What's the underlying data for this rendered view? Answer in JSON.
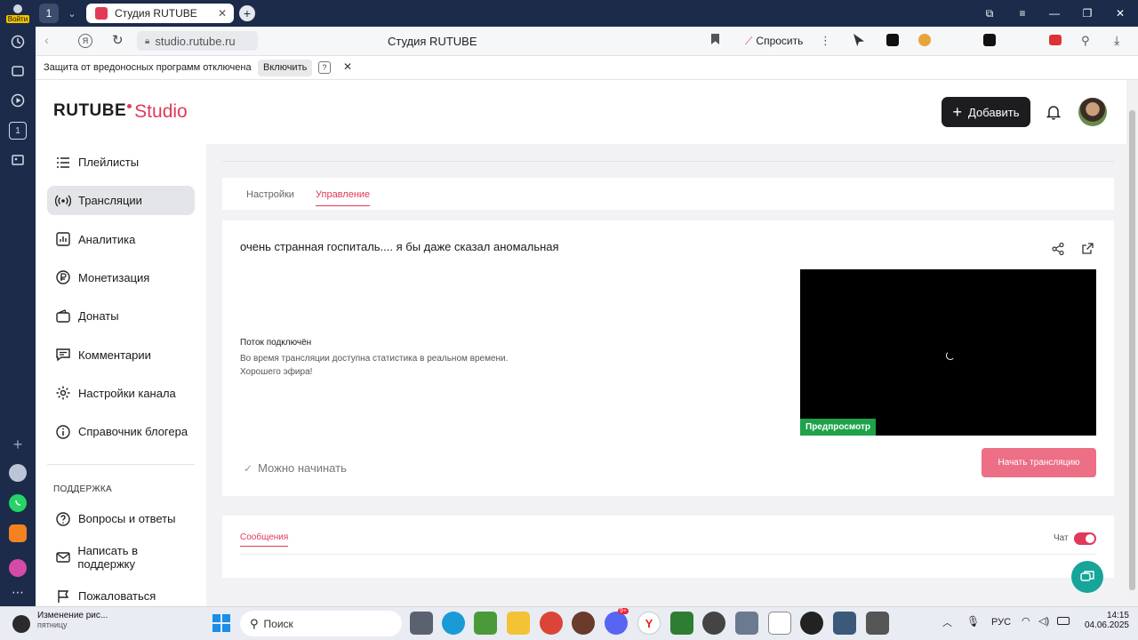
{
  "browser": {
    "login_label": "Войти",
    "tab_counter": "1",
    "tab_title": "Студия RUTUBE",
    "url": "studio.rutube.ru",
    "page_title": "Студия RUTUBE",
    "ask_label": "Спросить",
    "infobar_text": "Защита от вредоносных программ отключена",
    "infobar_button": "Включить",
    "infobar_help": "?"
  },
  "header": {
    "logo_main": "RUTUBE",
    "logo_studio": "Studio",
    "add_button": "Добавить"
  },
  "sidebar": {
    "items": [
      {
        "label": "Плейлисты",
        "icon": "list-icon"
      },
      {
        "label": "Трансляции",
        "icon": "broadcast-icon"
      },
      {
        "label": "Аналитика",
        "icon": "chart-icon"
      },
      {
        "label": "Монетизация",
        "icon": "ruble-icon"
      },
      {
        "label": "Донаты",
        "icon": "wallet-icon"
      },
      {
        "label": "Комментарии",
        "icon": "comment-icon"
      },
      {
        "label": "Настройки канала",
        "icon": "gear-icon"
      },
      {
        "label": "Справочник блогера",
        "icon": "info-icon"
      }
    ],
    "support_header": "ПОДДЕРЖКА",
    "support_items": [
      {
        "label": "Вопросы и ответы",
        "icon": "question-icon"
      },
      {
        "label": "Написать в поддержку",
        "icon": "mail-icon"
      },
      {
        "label": "Пожаловаться",
        "icon": "flag-icon"
      }
    ]
  },
  "main": {
    "tabs": [
      {
        "label": "Настройки"
      },
      {
        "label": "Управление"
      }
    ],
    "stream_title": "очень странная госпиталь.... я бы даже сказал аномальная",
    "status_title": "Поток подключён",
    "status_line1": "Во время трансляции доступна статистика в реальном времени.",
    "status_line2": "Хорошего эфира!",
    "preview_label": "Предпросмотр",
    "ready_label": "Можно начинать",
    "start_button": "Начать трансляцию",
    "messages_tab": "Сообщения",
    "chat_label": "Чат",
    "chat_enabled": true
  },
  "taskbar": {
    "notification_title": "Изменение рис...",
    "notification_sub": "пятницу",
    "search_placeholder": "Поиск",
    "discord_badge": "9+",
    "lang": "РУС",
    "time": "14:15",
    "date": "04.06.2025"
  },
  "colors": {
    "accent": "#e1395a",
    "brand_dark": "#1d1d1f",
    "chrome": "#1c2b4a",
    "preview_badge": "#1fa24a"
  }
}
